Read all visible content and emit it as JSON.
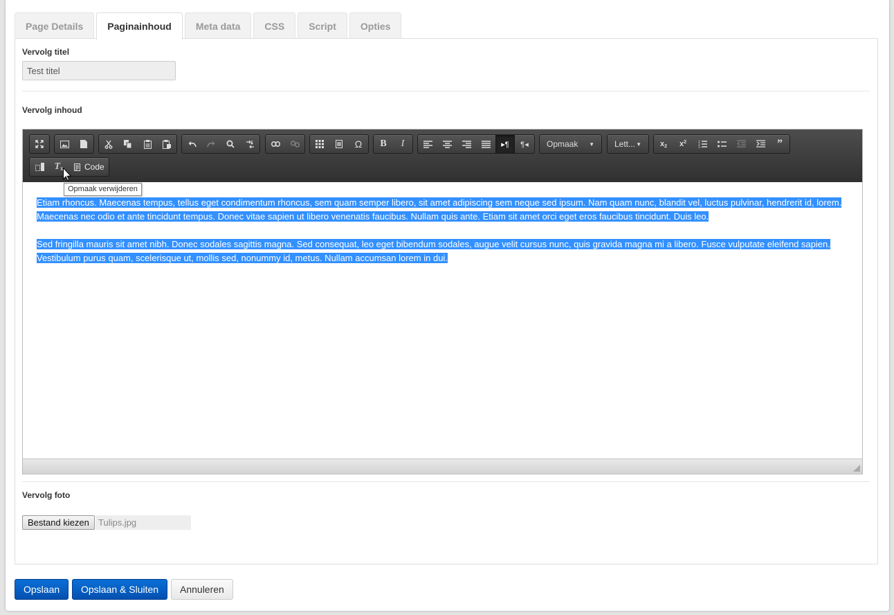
{
  "tabs": [
    {
      "label": "Page Details",
      "active": false
    },
    {
      "label": "Paginainhoud",
      "active": true
    },
    {
      "label": "Meta data",
      "active": false
    },
    {
      "label": "CSS",
      "active": false
    },
    {
      "label": "Script",
      "active": false
    },
    {
      "label": "Opties",
      "active": false
    }
  ],
  "title_field": {
    "label": "Vervolg titel",
    "value": "Test titel"
  },
  "content_field": {
    "label": "Vervolg inhoud"
  },
  "editor": {
    "format_dropdown": "Opmaak",
    "font_dropdown": "Lett...",
    "code_button": "Code",
    "tooltip": "Opmaak verwijderen",
    "paragraphs": [
      "Etiam rhoncus. Maecenas tempus, tellus eget condimentum rhoncus, sem quam semper libero, sit amet adipiscing sem neque sed ipsum. Nam quam nunc, blandit vel, luctus pulvinar, hendrerit id, lorem. Maecenas nec odio et ante tincidunt tempus. Donec vitae sapien ut libero venenatis faucibus. Nullam quis ante. Etiam sit amet orci eget eros faucibus tincidunt. Duis leo.",
      "Sed fringilla mauris sit amet nibh. Donec sodales sagittis magna. Sed consequat, leo eget bibendum sodales, augue velit cursus nunc, quis gravida magna mi a libero. Fusce vulputate eleifend sapien. Vestibulum purus quam, scelerisque ut, mollis sed, nonummy id, metus. Nullam accumsan lorem in dui."
    ],
    "selection_color": "#3390ff"
  },
  "photo_field": {
    "label": "Vervolg foto",
    "button": "Bestand kiezen",
    "filename": "Tulips.jpg"
  },
  "actions": {
    "save": "Opslaan",
    "save_close": "Opslaan & Sluiten",
    "cancel": "Annuleren"
  },
  "colors": {
    "primary": "#0b63c7",
    "toolbar": "#3a3a3a"
  }
}
